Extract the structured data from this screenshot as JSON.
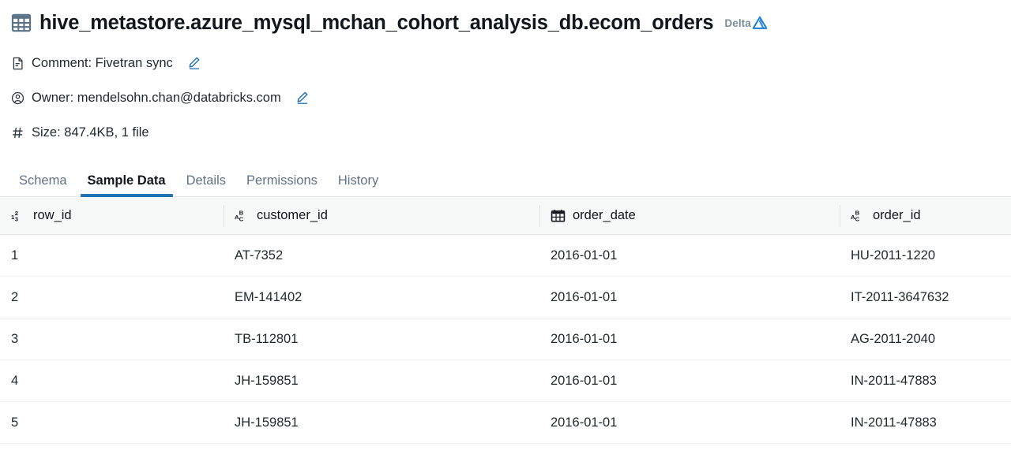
{
  "header": {
    "table_icon": "table-grid-icon",
    "title": "hive_metastore.azure_mysql_mchan_cohort_analysis_db.ecom_orders",
    "format_label": "Delta",
    "format_icon": "delta-triangle-logo"
  },
  "meta": [
    {
      "icon": "document-icon",
      "text": "Comment: Fivetran sync",
      "edit_icon": "pencil-icon",
      "name": "comment"
    },
    {
      "icon": "owner-person-icon",
      "text": "Owner: mendelsohn.chan@databricks.com",
      "edit_icon": "pencil-icon",
      "name": "owner"
    },
    {
      "icon": "hash-icon",
      "text": "Size: 847.4KB, 1 file",
      "name": "size"
    }
  ],
  "tabs": [
    {
      "label": "Schema",
      "active": false
    },
    {
      "label": "Sample Data",
      "active": true
    },
    {
      "label": "Details",
      "active": false
    },
    {
      "label": "Permissions",
      "active": false
    },
    {
      "label": "History",
      "active": false
    }
  ],
  "table": {
    "columns": [
      {
        "name": "row_id",
        "type_icon": "number-type-icon"
      },
      {
        "name": "customer_id",
        "type_icon": "string-type-icon"
      },
      {
        "name": "order_date",
        "type_icon": "calendar-type-icon"
      },
      {
        "name": "order_id",
        "type_icon": "string-type-icon"
      }
    ],
    "rows": [
      [
        "1",
        "AT-7352",
        "2016-01-01",
        "HU-2011-1220"
      ],
      [
        "2",
        "EM-141402",
        "2016-01-01",
        "IT-2011-3647632"
      ],
      [
        "3",
        "TB-112801",
        "2016-01-01",
        "AG-2011-2040"
      ],
      [
        "4",
        "JH-159851",
        "2016-01-01",
        "IN-2011-47883"
      ],
      [
        "5",
        "JH-159851",
        "2016-01-01",
        "IN-2011-47883"
      ]
    ]
  },
  "colors": {
    "accent": "#2272b4",
    "table_icon": "#5a7387",
    "muted_text": "#5f7281",
    "header_bg": "#f7f8f8"
  }
}
